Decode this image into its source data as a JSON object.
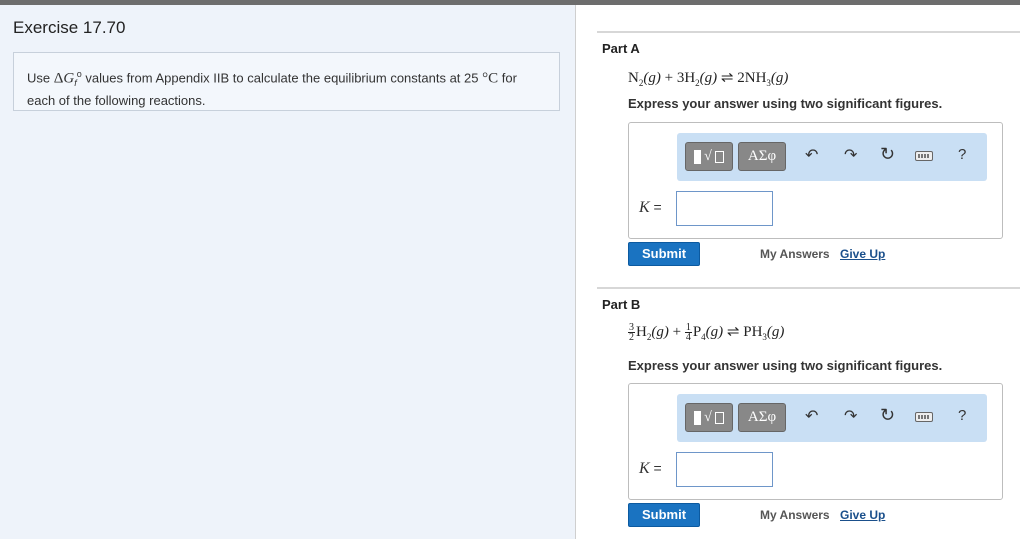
{
  "exercise": {
    "title": "Exercise 17.70",
    "problem": {
      "prefix": "Use ",
      "symbol_delta": "Δ",
      "symbol_g": "G",
      "symbol_sub": "f",
      "symbol_sup": "o",
      "middle": " values from Appendix IIB to calculate the equilibrium constants at 25 ",
      "degree": "°C",
      "suffix": " for each of the following reactions."
    }
  },
  "parts": [
    {
      "title": "Part A",
      "equation": {
        "r1": "N",
        "r1_sub": "2",
        "r1_phase": "(g)",
        "plus": " + ",
        "r2": "3H",
        "r2_sub": "2",
        "r2_phase": "(g)",
        "arrow": " ⇌ ",
        "p1": "2NH",
        "p1_sub": "3",
        "p1_phase": "(g)"
      },
      "instruction": "Express your answer using two significant figures.",
      "toolbar": {
        "templates_icon": "templates-icon",
        "greek_label": "ΑΣφ"
      },
      "k_label_var": "K",
      "k_label_eq": " =",
      "k_value": "",
      "submit_label": "Submit",
      "my_answers_label": "My Answers",
      "give_up_label": "Give Up"
    },
    {
      "title": "Part B",
      "equation": {
        "f1_num": "3",
        "f1_den": "2",
        "r1": "H",
        "r1_sub": "2",
        "r1_phase": "(g)",
        "plus": " + ",
        "f2_num": "1",
        "f2_den": "4",
        "r2": "P",
        "r2_sub": "4",
        "r2_phase": "(g)",
        "arrow": " ⇌ ",
        "p1": "PH",
        "p1_sub": "3",
        "p1_phase": "(g)"
      },
      "instruction": "Express your answer using two significant figures.",
      "toolbar": {
        "templates_icon": "templates-icon",
        "greek_label": "ΑΣφ"
      },
      "k_label_var": "K",
      "k_label_eq": " =",
      "k_value": "",
      "submit_label": "Submit",
      "my_answers_label": "My Answers",
      "give_up_label": "Give Up"
    }
  ],
  "icons": {
    "undo": "↶",
    "redo": "↷",
    "reset": "↻",
    "help": "?"
  },
  "colors": {
    "submit_bg": "#1a73c1",
    "toolbar_bg": "#c9dff4",
    "left_panel_bg": "#eef3fa",
    "link": "#1a4f8b"
  }
}
